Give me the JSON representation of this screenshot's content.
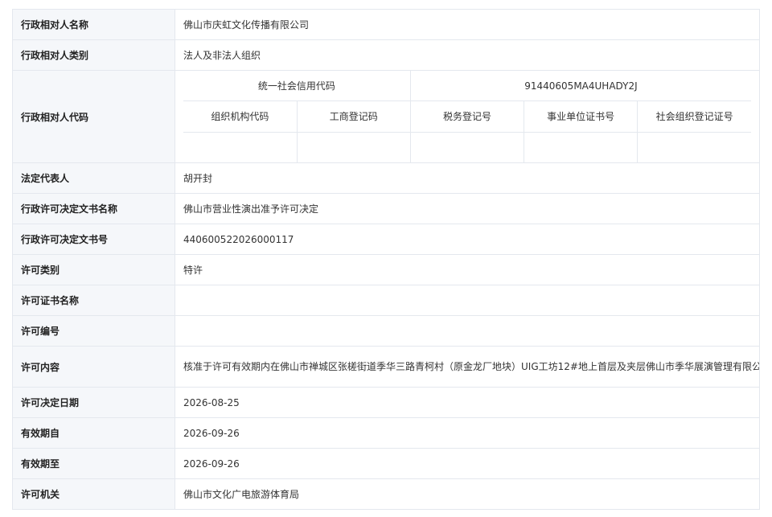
{
  "rows": {
    "name": {
      "label": "行政相对人名称",
      "value": "佛山市庆虹文化传播有限公司"
    },
    "type": {
      "label": "行政相对人类别",
      "value": "法人及非法人组织"
    },
    "code": {
      "label": "行政相对人代码",
      "uscc_label": "统一社会信用代码",
      "uscc_value": "91440605MA4UHADY2J",
      "sub_headers": [
        "组织机构代码",
        "工商登记码",
        "税务登记号",
        "事业单位证书号",
        "社会组织登记证号"
      ],
      "sub_values": [
        "",
        "",
        "",
        "",
        ""
      ]
    },
    "legal_rep": {
      "label": "法定代表人",
      "value": "胡开封"
    },
    "doc_name": {
      "label": "行政许可决定文书名称",
      "value": "佛山市营业性演出准予许可决定"
    },
    "doc_no": {
      "label": "行政许可决定文书号",
      "value": "440600522026000117"
    },
    "category": {
      "label": "许可类别",
      "value": "特许"
    },
    "cert_name": {
      "label": "许可证书名称",
      "value": ""
    },
    "permit_no": {
      "label": "许可编号",
      "value": ""
    },
    "content": {
      "label": "许可内容",
      "value": "核准于许可有效期内在佛山市禅城区张槎街道季华三路青柯村（原金龙厂地块）UIG工坊12#地上首层及夹层佛山市季华展演管理有限公司举办布志纶“摇滚进行中”巡回演唱会佛山站"
    },
    "decision_date": {
      "label": "许可决定日期",
      "value": "2026-08-25"
    },
    "valid_from": {
      "label": "有效期自",
      "value": "2026-09-26"
    },
    "valid_to": {
      "label": "有效期至",
      "value": "2026-09-26"
    },
    "authority": {
      "label": "许可机关",
      "value": "佛山市文化广电旅游体育局"
    }
  }
}
